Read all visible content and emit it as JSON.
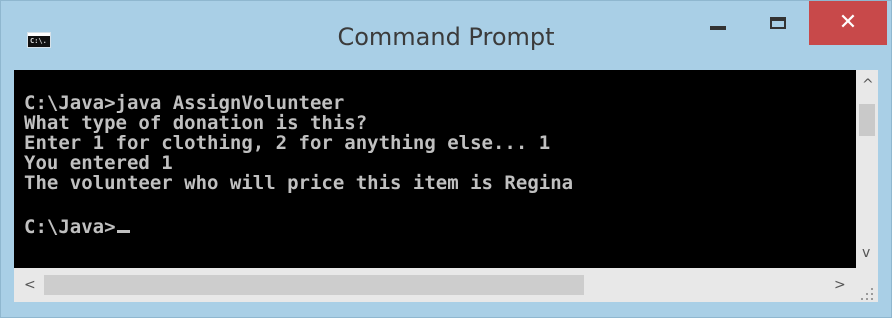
{
  "window": {
    "title": "Command Prompt",
    "icon": "cmd-app-icon",
    "icon_text": "C:\\.",
    "controls": {
      "minimize_icon": "minimize-icon",
      "maximize_icon": "maximize-icon",
      "close_icon": "close-icon",
      "close_glyph": "✕"
    },
    "colors": {
      "frame": "#a9cfe6",
      "console_bg": "#000000",
      "console_text": "#c0c0c0",
      "close_button": "#c8494a"
    }
  },
  "console": {
    "lines": [
      "C:\\Java>java AssignVolunteer",
      "What type of donation is this?",
      "Enter 1 for clothing, 2 for anything else... 1",
      "You entered 1",
      "The volunteer who will price this item is Regina",
      "",
      "C:\\Java>"
    ]
  },
  "scrollbars": {
    "up_arrow": "^",
    "down_arrow": "v",
    "left_arrow": "<",
    "right_arrow": ">"
  }
}
